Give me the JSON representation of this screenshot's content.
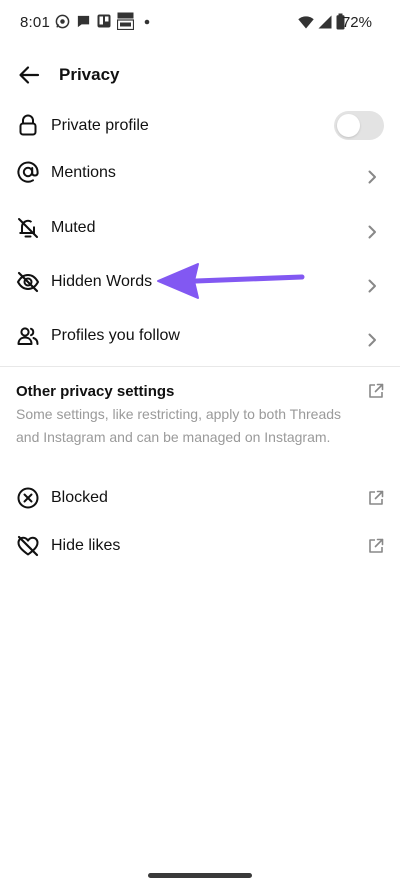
{
  "status_bar": {
    "time": "8:01",
    "battery": "72%",
    "icons": [
      "whatsapp-icon",
      "chat-icon",
      "trello-icon",
      "tata-icon",
      "dot-icon",
      "wifi-icon",
      "signal-icon",
      "battery-icon"
    ]
  },
  "header": {
    "title": "Privacy",
    "back_icon": "arrow-left-icon"
  },
  "rows": [
    {
      "label": "Private profile",
      "icon": "lock-icon",
      "control": "toggle",
      "toggle_on": false
    },
    {
      "label": "Mentions",
      "icon": "at-sign-icon",
      "control": "chevron"
    },
    {
      "label": "Muted",
      "icon": "bell-off-icon",
      "control": "chevron"
    },
    {
      "label": "Hidden Words",
      "icon": "eye-off-icon",
      "control": "chevron"
    },
    {
      "label": "Profiles you follow",
      "icon": "users-icon",
      "control": "chevron"
    }
  ],
  "other_section": {
    "title": "Other privacy settings",
    "description": "Some settings, like restricting, apply to both Threads and Instagram and can be managed on Instagram.",
    "rows": [
      {
        "label": "Blocked",
        "icon": "x-circle-icon",
        "control": "external-link"
      },
      {
        "label": "Hide likes",
        "icon": "heart-off-icon",
        "control": "external-link"
      }
    ]
  },
  "annotation": {
    "icon": "arrow-pointer-icon",
    "color": "#8258f2"
  },
  "colors": {
    "toggle_track": "#e3e3e3",
    "muted_text": "#9a9a9a",
    "accent_arrow": "#8258f2"
  }
}
